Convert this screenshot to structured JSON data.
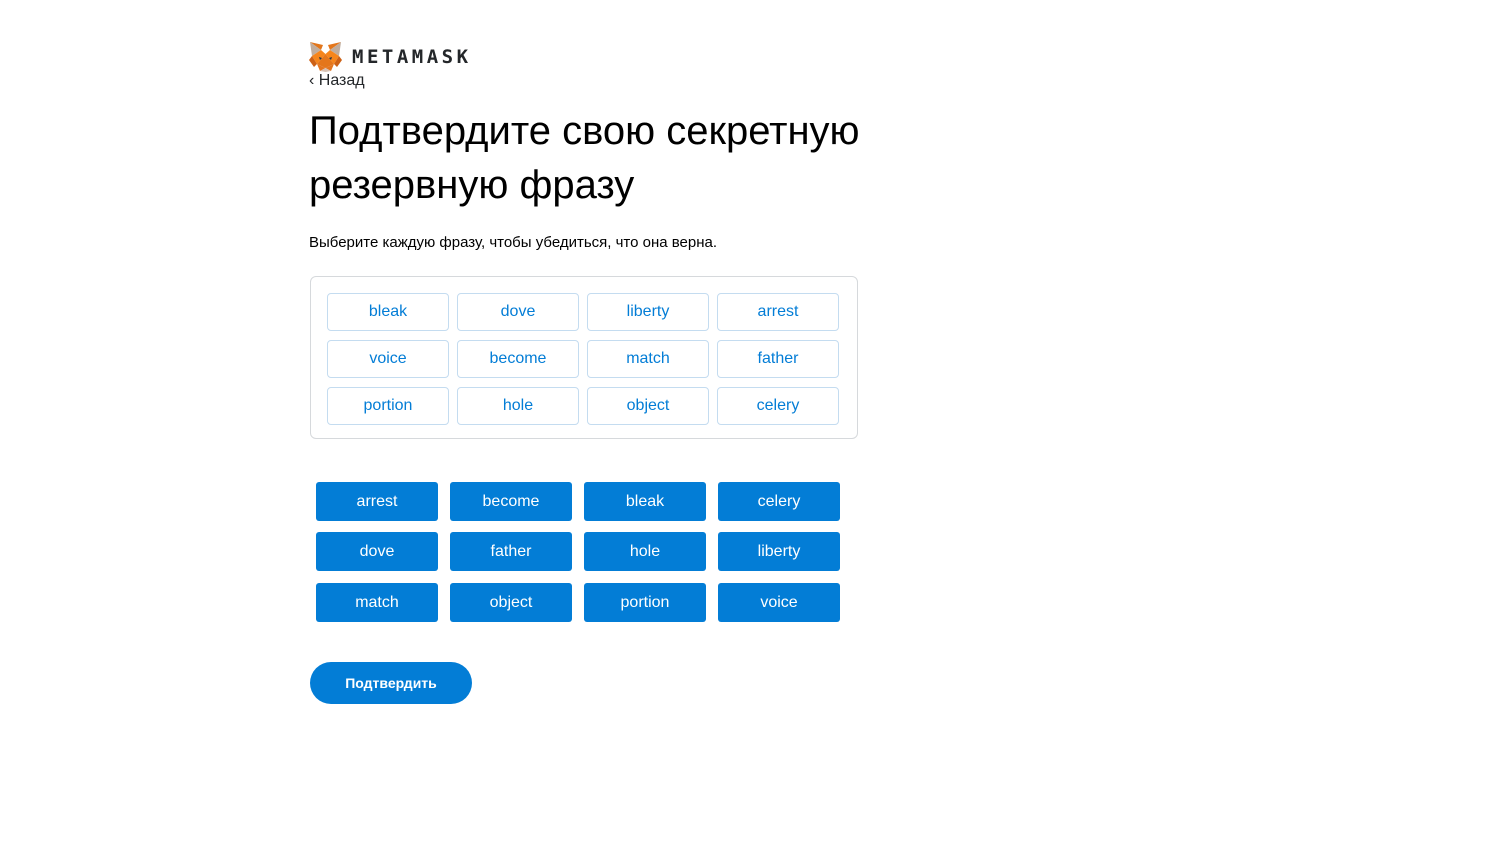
{
  "header": {
    "logo_icon": "metamask-fox-icon",
    "brand": "METAMASK",
    "back_label": "‹ Назад"
  },
  "main": {
    "title": "Подтвердите свою секретную резервную фразу",
    "subtitle": "Выберите каждую фразу, чтобы убедиться, что она верна.",
    "selected_words": [
      "bleak",
      "dove",
      "liberty",
      "arrest",
      "voice",
      "become",
      "match",
      "father",
      "portion",
      "hole",
      "object",
      "celery"
    ],
    "available_words": [
      "arrest",
      "become",
      "bleak",
      "celery",
      "dove",
      "father",
      "hole",
      "liberty",
      "match",
      "object",
      "portion",
      "voice"
    ],
    "confirm_label": "Подтвердить"
  },
  "colors": {
    "accent": "#037dd6",
    "text": "#24272a",
    "border": "#d6d9dc",
    "fox_orange": "#e2761b"
  }
}
